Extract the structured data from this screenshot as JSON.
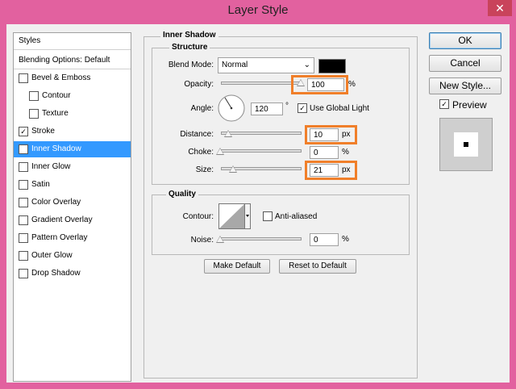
{
  "window": {
    "title": "Layer Style",
    "close_glyph": "✕"
  },
  "styles_panel": {
    "header": "Styles",
    "blending_options": "Blending Options: Default",
    "items": [
      {
        "label": "Bevel & Emboss",
        "checked": false,
        "indent": false
      },
      {
        "label": "Contour",
        "checked": false,
        "indent": true
      },
      {
        "label": "Texture",
        "checked": false,
        "indent": true
      },
      {
        "label": "Stroke",
        "checked": true,
        "indent": false
      },
      {
        "label": "Inner Shadow",
        "checked": true,
        "indent": false,
        "selected": true
      },
      {
        "label": "Inner Glow",
        "checked": false,
        "indent": false
      },
      {
        "label": "Satin",
        "checked": false,
        "indent": false
      },
      {
        "label": "Color Overlay",
        "checked": false,
        "indent": false
      },
      {
        "label": "Gradient Overlay",
        "checked": false,
        "indent": false
      },
      {
        "label": "Pattern Overlay",
        "checked": false,
        "indent": false
      },
      {
        "label": "Outer Glow",
        "checked": false,
        "indent": false
      },
      {
        "label": "Drop Shadow",
        "checked": false,
        "indent": false
      }
    ],
    "check_glyph": "✓"
  },
  "inner_shadow": {
    "title": "Inner Shadow",
    "structure": {
      "title": "Structure",
      "blend_mode_label": "Blend Mode:",
      "blend_mode_value": "Normal",
      "shadow_color": "#000000",
      "opacity_label": "Opacity:",
      "opacity_value": "100",
      "opacity_unit": "%",
      "opacity_level": 1.0,
      "angle_label": "Angle:",
      "angle_value": "120",
      "angle_unit": "°",
      "use_global_light_label": "Use Global Light",
      "use_global_light_checked": true,
      "distance_label": "Distance:",
      "distance_value": "10",
      "distance_unit": "px",
      "choke_label": "Choke:",
      "choke_value": "0",
      "choke_unit": "%",
      "size_label": "Size:",
      "size_value": "21",
      "size_unit": "px"
    },
    "quality": {
      "title": "Quality",
      "contour_label": "Contour:",
      "anti_aliased_label": "Anti-aliased",
      "anti_aliased_checked": false,
      "noise_label": "Noise:",
      "noise_value": "0",
      "noise_unit": "%"
    },
    "make_default_label": "Make Default",
    "reset_default_label": "Reset to Default"
  },
  "right_panel": {
    "ok_label": "OK",
    "cancel_label": "Cancel",
    "new_style_label": "New Style...",
    "preview_label": "Preview",
    "preview_checked": true
  },
  "colors": {
    "highlight": "#f07f2a",
    "selection": "#3399ff",
    "titlebar": "#e2619f"
  }
}
